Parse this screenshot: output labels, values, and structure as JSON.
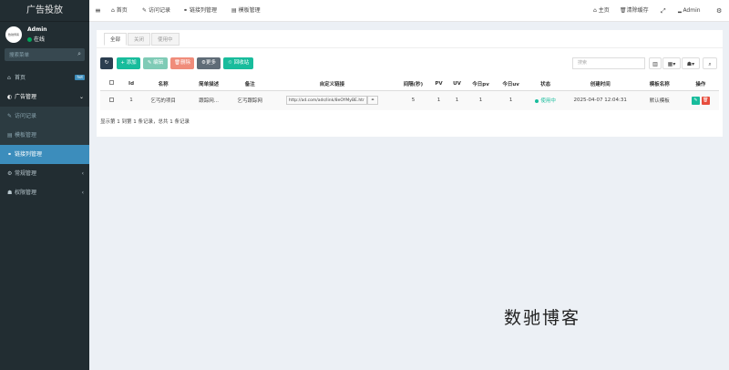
{
  "app": {
    "title": "广告投放"
  },
  "user": {
    "avatar_text": "数驰博客",
    "name": "Admin",
    "status": "在线"
  },
  "sidebar": {
    "search_placeholder": "搜索菜单",
    "items": [
      {
        "label": "首页",
        "badge": "hot"
      },
      {
        "label": "广告管理"
      },
      {
        "label": "访问记录"
      },
      {
        "label": "模板管理"
      },
      {
        "label": "链接列管理"
      },
      {
        "label": "常规管理"
      },
      {
        "label": "权限管理"
      }
    ]
  },
  "topbar": {
    "menu_icon": "≡",
    "tabs": [
      "首页",
      "访问记录",
      "链接列管理",
      "模板管理"
    ],
    "right": {
      "home": "主页",
      "clear_cache": "清除缓存",
      "user": "Admin"
    }
  },
  "card": {
    "tabs": [
      "全部",
      "关闭",
      "使用中"
    ],
    "toolbar": {
      "add": "添加",
      "edit": "编辑",
      "delete": "删除",
      "more": "更多",
      "recycle": "回收站",
      "search_placeholder": "搜索"
    },
    "columns": [
      "Id",
      "名称",
      "简单描述",
      "备注",
      "自定义链接",
      "间隔(秒)",
      "PV",
      "UV",
      "今日pv",
      "今日uv",
      "状态",
      "创建时间",
      "模板名称",
      "操作"
    ],
    "rows": [
      {
        "id": "1",
        "name": "乞丐的项目",
        "desc": "跟踪网...",
        "remark": "乞丐跟踪网",
        "link": "http://ad.com/ads/link/8eOYMyBE.htr",
        "interval": "5",
        "pv": "1",
        "uv": "1",
        "today_pv": "1",
        "today_uv": "1",
        "status": "使用中",
        "created": "2025-04-07 12:04:31",
        "template": "默认模板"
      }
    ],
    "summary": "显示第 1 到第 1 条记录，总共 1 条记录"
  },
  "watermark": "数驰博客",
  "colors": {
    "sidebar": "#222d32",
    "active": "#3c8dbc",
    "add": "#18bc9c",
    "edit": "#7fcbb6",
    "delete": "#f08c7a",
    "more": "#5f6c77",
    "recycle": "#18bc9c",
    "refresh": "#2c3e50"
  }
}
